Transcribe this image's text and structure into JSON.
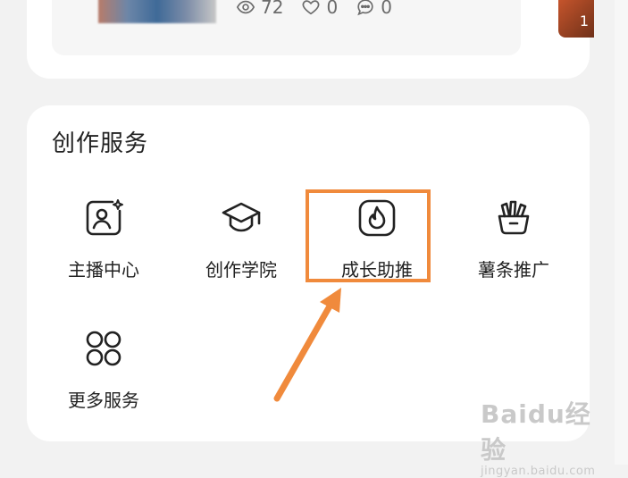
{
  "post": {
    "views": "72",
    "likes": "0",
    "comments": "0",
    "right_thumb_text": "1"
  },
  "services": {
    "title": "创作服务",
    "items": [
      {
        "label": "主播中心",
        "icon": "anchor-center-icon"
      },
      {
        "label": "创作学院",
        "icon": "graduation-cap-icon"
      },
      {
        "label": "成长助推",
        "icon": "flame-icon"
      },
      {
        "label": "薯条推广",
        "icon": "fries-icon"
      },
      {
        "label": "更多服务",
        "icon": "more-grid-icon"
      }
    ]
  },
  "colors": {
    "highlight": "#f08a3c",
    "card": "#ffffff",
    "background": "#f2f2f2"
  },
  "watermark": {
    "main": "Baidu经验",
    "sub": "jingyan.baidu.com"
  }
}
